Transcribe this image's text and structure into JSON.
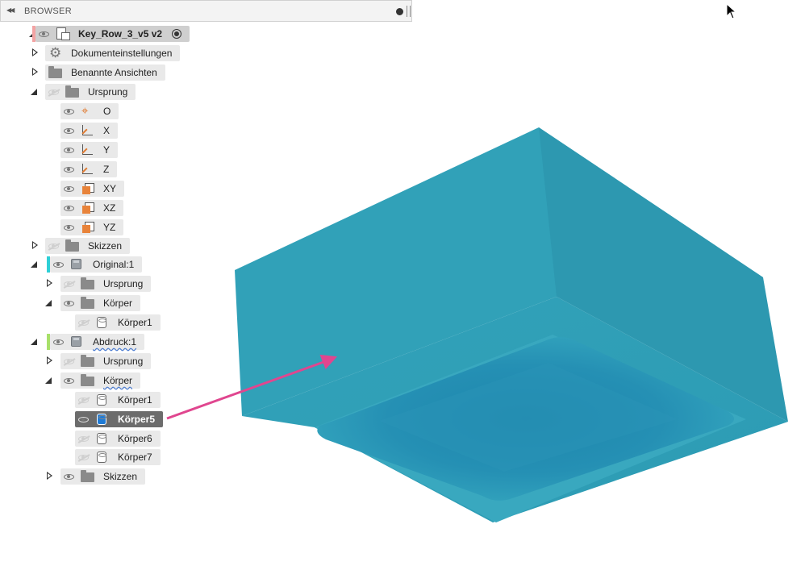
{
  "browser": {
    "title": "BROWSER",
    "collapse_icon": "double-left-arrow-icon",
    "pin_icon": "pin-icon"
  },
  "tree": {
    "root": {
      "label": "Key_Row_3_v5 v2",
      "expanded": true,
      "color": "#f3a3a3"
    },
    "items": [
      {
        "label": "Dokumenteinstellungen",
        "icon": "gear-icon",
        "expander": "collapsed"
      },
      {
        "label": "Benannte Ansichten",
        "icon": "folder-icon",
        "expander": "collapsed"
      },
      {
        "label": "Ursprung",
        "icon": "folder-icon",
        "expander": "expanded",
        "visible": false
      },
      {
        "label": "O",
        "icon": "origin-point-icon"
      },
      {
        "label": "X",
        "icon": "axis-icon"
      },
      {
        "label": "Y",
        "icon": "axis-icon"
      },
      {
        "label": "Z",
        "icon": "axis-icon"
      },
      {
        "label": "XY",
        "icon": "plane-icon"
      },
      {
        "label": "XZ",
        "icon": "plane-icon"
      },
      {
        "label": "YZ",
        "icon": "plane-icon"
      },
      {
        "label": "Skizzen",
        "icon": "folder-icon",
        "expander": "collapsed",
        "visible": false
      },
      {
        "label": "Original:1",
        "icon": "component-icon",
        "expander": "expanded",
        "color": "#2ecfd6"
      },
      {
        "label": "Ursprung",
        "icon": "folder-icon",
        "expander": "collapsed",
        "visible": false
      },
      {
        "label": "Körper",
        "icon": "folder-icon",
        "expander": "expanded"
      },
      {
        "label": "Körper1",
        "icon": "body-icon",
        "visible": false
      },
      {
        "label": "Abdruck:1",
        "icon": "component-icon",
        "expander": "expanded",
        "color": "#a8e06a"
      },
      {
        "label": "Ursprung",
        "icon": "folder-icon",
        "expander": "collapsed",
        "visible": false
      },
      {
        "label": "Körper",
        "icon": "folder-icon",
        "expander": "expanded"
      },
      {
        "label": "Körper1",
        "icon": "body-icon",
        "visible": false
      },
      {
        "label": "Körper5",
        "icon": "body-icon",
        "visible": true,
        "selected": true
      },
      {
        "label": "Körper6",
        "icon": "body-icon",
        "visible": false
      },
      {
        "label": "Körper7",
        "icon": "body-icon",
        "visible": false
      },
      {
        "label": "Skizzen",
        "icon": "folder-icon",
        "expander": "collapsed"
      }
    ]
  },
  "viewport": {
    "model_color": "#2e9fb6",
    "annotation_arrow_color": "#e0468f"
  }
}
